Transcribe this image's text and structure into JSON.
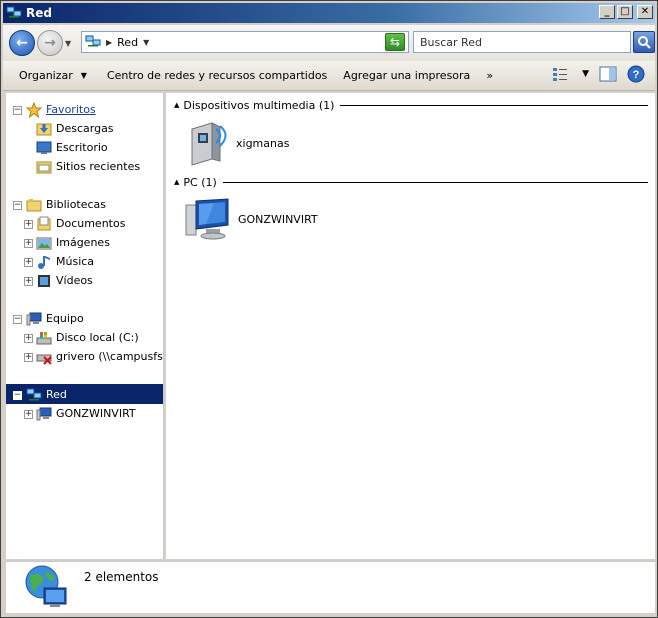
{
  "window": {
    "title": "Red",
    "buttons": {
      "minimize": "_",
      "maximize": "□",
      "close": "✕"
    }
  },
  "nav": {
    "address_crumb": "Red",
    "search_placeholder": "Buscar Red"
  },
  "commandbar": {
    "organize": "Organizar",
    "network_center": "Centro de redes y recursos compartidos",
    "add_printer": "Agregar una impresora",
    "more": "»"
  },
  "sidebar": {
    "favorites": {
      "label": "Favoritos",
      "items": [
        {
          "label": "Descargas"
        },
        {
          "label": "Escritorio"
        },
        {
          "label": "Sitios recientes"
        }
      ]
    },
    "libraries": {
      "label": "Bibliotecas",
      "items": [
        {
          "label": "Documentos"
        },
        {
          "label": "Imágenes"
        },
        {
          "label": "Música"
        },
        {
          "label": "Vídeos"
        }
      ]
    },
    "computer": {
      "label": "Equipo",
      "items": [
        {
          "label": "Disco local (C:)"
        },
        {
          "label": "grivero (\\\\campusfs.uc"
        }
      ]
    },
    "network": {
      "label": "Red",
      "items": [
        {
          "label": "GONZWINVIRT"
        }
      ]
    }
  },
  "content": {
    "groups": [
      {
        "label": "Dispositivos multimedia (1)",
        "items": [
          {
            "label": "xigmanas",
            "icon": "media-server-icon"
          }
        ]
      },
      {
        "label": "PC (1)",
        "items": [
          {
            "label": "GONZWINVIRT",
            "icon": "computer-icon"
          }
        ]
      }
    ]
  },
  "status": {
    "count": "2 elementos"
  }
}
